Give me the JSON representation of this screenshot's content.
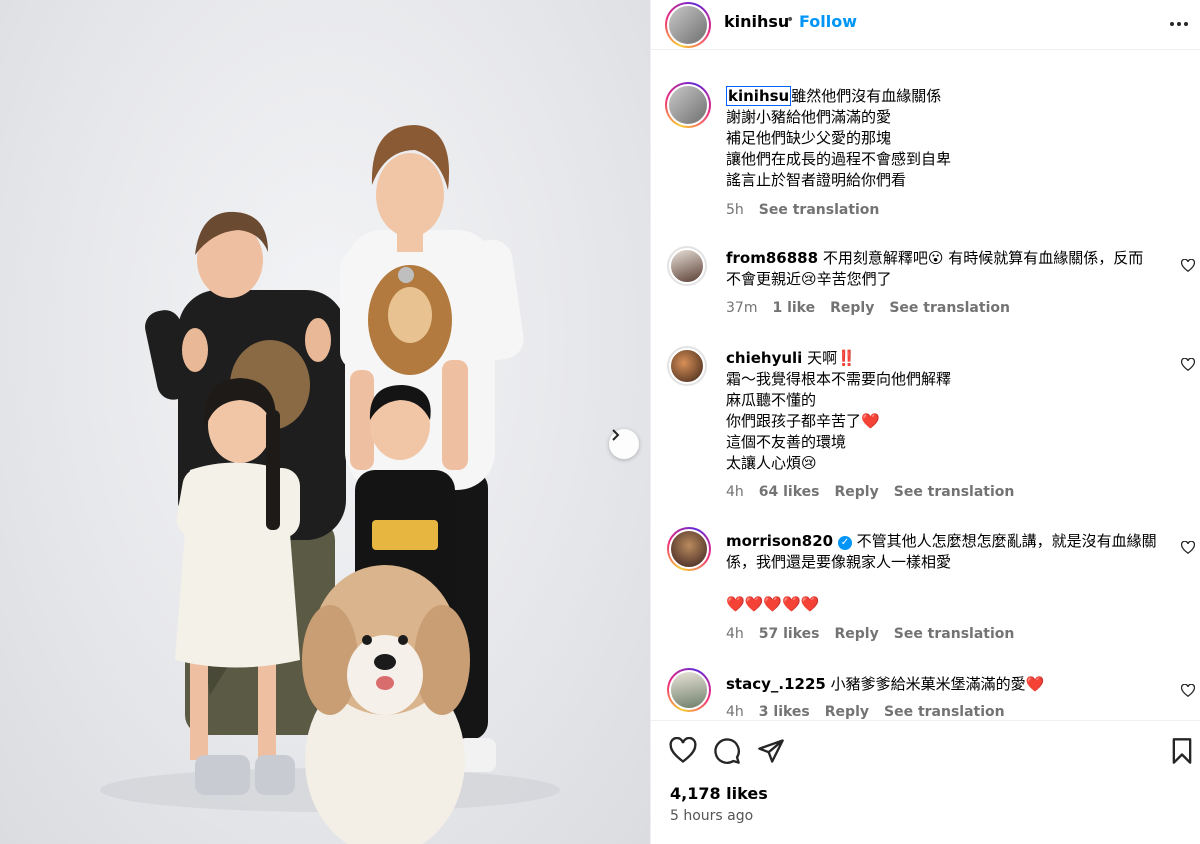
{
  "post": {
    "username": "kinihsu",
    "follow_label": "Follow",
    "caption": {
      "lines": [
        "雖然他們沒有血緣關係",
        "謝謝小豬給他們滿滿的愛",
        "補足他們缺少父愛的那塊",
        "讓他們在成長的過程不會感到自卑",
        "謠言止於智者證明給你們看"
      ],
      "time": "5h",
      "translate": "See translation"
    },
    "likes": "4,178 likes",
    "time_ago": "5 hours ago"
  },
  "comments": [
    {
      "username": "from86888",
      "lines": [
        "不用刻意解釋吧😮 有時候就算有血緣關係，反而",
        "不會更親近😢辛苦您們了"
      ],
      "time": "37m",
      "likes": "1 like",
      "reply": "Reply",
      "translate": "See translation"
    },
    {
      "username": "chiehyuli",
      "lines": [
        "天啊‼️",
        "霜～我覺得根本不需要向他們解釋",
        "麻瓜聽不懂的",
        "你們跟孩子都辛苦了❤️",
        "這個不友善的環境",
        "太讓人心煩😢"
      ],
      "time": "4h",
      "likes": "64 likes",
      "reply": "Reply",
      "translate": "See translation"
    },
    {
      "username": "morrison820",
      "lines": [
        "不管其他人怎麼想怎麼亂講，就是沒有血緣關",
        "係，我們還是要像親家人一樣相愛",
        "",
        "❤️❤️❤️❤️❤️"
      ],
      "time": "4h",
      "likes": "57 likes",
      "reply": "Reply",
      "translate": "See translation"
    },
    {
      "username": "stacy_.1225",
      "lines": [
        "小豬爹爹給米菓米堡滿滿的愛❤️"
      ],
      "time": "4h",
      "likes": "3 likes",
      "reply": "Reply",
      "translate": "See translation"
    }
  ],
  "icons": {
    "more": "more-horizontal-icon",
    "next": "chevron-right-icon",
    "like": "heart-icon",
    "comment": "comment-icon",
    "share": "send-icon",
    "save": "bookmark-icon"
  },
  "colors": {
    "follow": "#0095f6",
    "verified": "#0095f6",
    "meta": "#737373"
  }
}
